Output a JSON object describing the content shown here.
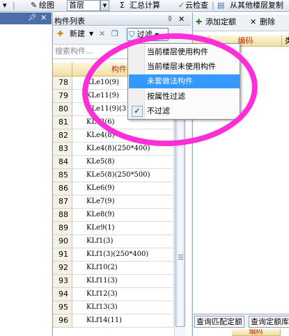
{
  "toolbar": {
    "draw_label": "绘图",
    "floor_value": "首层",
    "sum_label": "汇总计算",
    "cloud_check_label": "云检查",
    "copy_from_floor_label": "从其他楼层复制"
  },
  "component_list": {
    "title": "构件列表",
    "new_label": "新建",
    "filter_label": "过滤",
    "search_placeholder": "搜索构件...",
    "column_name": "构件名",
    "rows": [
      {
        "num": "78",
        "name": "KLe10(9)"
      },
      {
        "num": "79",
        "name": "KLe11(9)"
      },
      {
        "num": "80",
        "name": "KLe11(9)(3"
      },
      {
        "num": "81",
        "name": "KLe2(6)"
      },
      {
        "num": "82",
        "name": "KLe4(8)"
      },
      {
        "num": "83",
        "name": "KLe4(8)(250*400)"
      },
      {
        "num": "84",
        "name": "KLe5(8)"
      },
      {
        "num": "85",
        "name": "KLe5(8)(250*500)"
      },
      {
        "num": "86",
        "name": "KLe6(9)"
      },
      {
        "num": "87",
        "name": "KLe7(9)"
      },
      {
        "num": "88",
        "name": "KLe8(9)"
      },
      {
        "num": "89",
        "name": "KLe9(1)"
      },
      {
        "num": "90",
        "name": "KLf1(3)"
      },
      {
        "num": "91",
        "name": "KLf1(3)(250*400)"
      },
      {
        "num": "92",
        "name": "KLf10(2)"
      },
      {
        "num": "93",
        "name": "KLf11(3)"
      },
      {
        "num": "94",
        "name": "KLf12(3)"
      },
      {
        "num": "95",
        "name": "KLf13(3)"
      },
      {
        "num": "96",
        "name": "KLf14(11)"
      }
    ]
  },
  "filter_menu": {
    "items": [
      {
        "label": "当前楼层使用构件",
        "selected": false,
        "checked": false
      },
      {
        "label": "当前楼层未使用构件",
        "selected": false,
        "checked": false
      },
      {
        "label": "未套做法构件",
        "selected": true,
        "checked": false
      },
      {
        "label": "按属性过滤",
        "selected": false,
        "checked": false
      },
      {
        "label": "不过滤",
        "selected": false,
        "checked": true
      }
    ]
  },
  "right_panel": {
    "add_quota_label": "添加定额",
    "delete_label": "删除",
    "col_code": "编码",
    "col_type": "类",
    "tabs": [
      "查询匹配定额",
      "查询定额库"
    ],
    "bottom_col_code": "编码"
  },
  "colors": {
    "annotation": "#ff2ed8",
    "menu_highlight": "#3399ff",
    "header_text": "#c03000"
  }
}
